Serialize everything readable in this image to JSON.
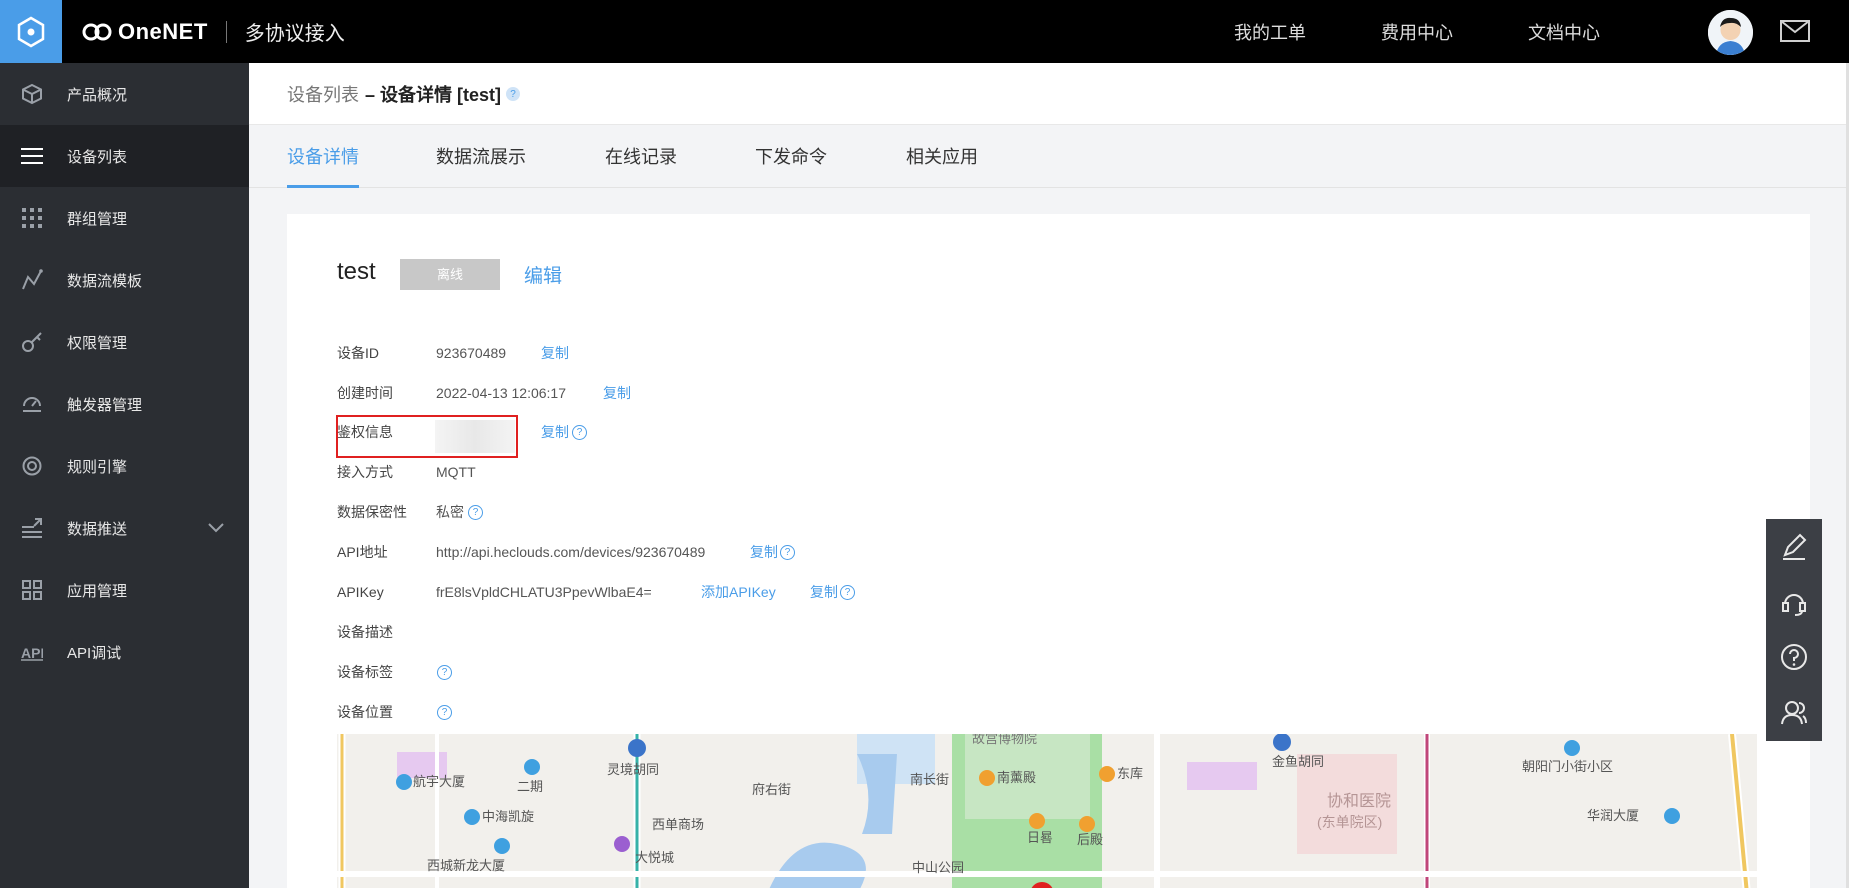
{
  "topbar": {
    "brand_name": "OneNET",
    "brand_sub": "多协议接入",
    "nav": [
      "我的工单",
      "费用中心",
      "文档中心"
    ]
  },
  "sidebar": {
    "items": [
      {
        "label": "产品概况",
        "icon": "cube-icon"
      },
      {
        "label": "设备列表",
        "icon": "list-icon"
      },
      {
        "label": "群组管理",
        "icon": "grid-dots-icon"
      },
      {
        "label": "数据流模板",
        "icon": "chart-line-icon"
      },
      {
        "label": "权限管理",
        "icon": "key-icon"
      },
      {
        "label": "触发器管理",
        "icon": "trigger-icon"
      },
      {
        "label": "规则引擎",
        "icon": "target-icon"
      },
      {
        "label": "数据推送",
        "icon": "push-icon"
      },
      {
        "label": "应用管理",
        "icon": "apps-icon"
      },
      {
        "label": "API调试",
        "icon": "api-icon"
      }
    ],
    "active_index": 1
  },
  "breadcrumb": {
    "parent": "设备列表",
    "current": "– 设备详情 [test]"
  },
  "tabs": [
    "设备详情",
    "数据流展示",
    "在线记录",
    "下发命令",
    "相关应用"
  ],
  "device": {
    "name": "test",
    "status": "离线",
    "edit_label": "编辑",
    "fields": {
      "id_label": "设备ID",
      "id_value": "923670489",
      "created_label": "创建时间",
      "created_value": "2022-04-13 12:06:17",
      "auth_label": "鉴权信息",
      "access_label": "接入方式",
      "access_value": "MQTT",
      "privacy_label": "数据保密性",
      "privacy_value": "私密",
      "api_label": "API地址",
      "api_value": "http://api.heclouds.com/devices/923670489",
      "apikey_label": "APIKey",
      "apikey_value": "frE8lsVpldCHLATU3PpevWlbaE4=",
      "add_apikey_label": "添加APIKey",
      "desc_label": "设备描述",
      "tags_label": "设备标签",
      "location_label": "设备位置"
    },
    "copy_label": "复制"
  },
  "map": {
    "labels": [
      "故宫博物院",
      "航宇大厦",
      "二期",
      "灵境胡同",
      "中海凯旋",
      "西单商场",
      "府右街",
      "南薰殿",
      "东库",
      "南长街",
      "日晷",
      "后殿",
      "西城新龙大厦",
      "大悦城",
      "中山公园",
      "金鱼胡同",
      "协和医院",
      "(东单院区)",
      "朝阳门小街小区",
      "华润大厦"
    ]
  },
  "colors": {
    "accent": "#4a9de8",
    "sidebar_bg": "#2b2e33",
    "topbar_bg": "#000000",
    "highlight_red": "#e02020"
  }
}
